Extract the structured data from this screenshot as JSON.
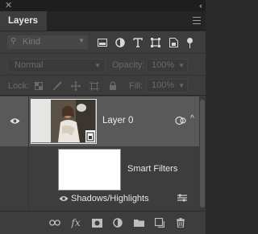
{
  "window": {
    "close_glyph": "✕",
    "collapse_glyph": "‹‹"
  },
  "panel": {
    "tab_title": "Layers",
    "menu_icon": "panel-menu-icon"
  },
  "filter": {
    "kind_label": "Kind",
    "icons": [
      "image-filter-icon",
      "adjustment-filter-icon",
      "type-filter-icon",
      "shape-filter-icon",
      "smart-object-filter-icon"
    ]
  },
  "blending": {
    "mode": "Normal",
    "opacity_label": "Opacity:",
    "opacity_value": "100%"
  },
  "lock": {
    "label": "Lock:",
    "icons": [
      "lock-transparent-pixels-icon",
      "lock-image-pixels-icon",
      "lock-position-icon",
      "lock-artboard-icon",
      "lock-all-icon"
    ],
    "fill_label": "Fill:",
    "fill_value": "100%"
  },
  "layers": [
    {
      "name": "Layer 0",
      "visible": true,
      "type": "smart-object",
      "filters_label": "Smart Filters",
      "filters": [
        {
          "name": "Shadows/Highlights",
          "visible": true
        }
      ]
    }
  ],
  "footer": {
    "icons": [
      "link-layers-icon",
      "fx-icon",
      "add-mask-icon",
      "new-adjustment-layer-icon",
      "new-group-icon",
      "new-layer-icon",
      "delete-layer-icon"
    ],
    "fx_label": "fx"
  },
  "colors": {
    "panel_bg": "#3d3d3d",
    "selected_row": "#595959",
    "titlebar": "#1e1e1e"
  }
}
